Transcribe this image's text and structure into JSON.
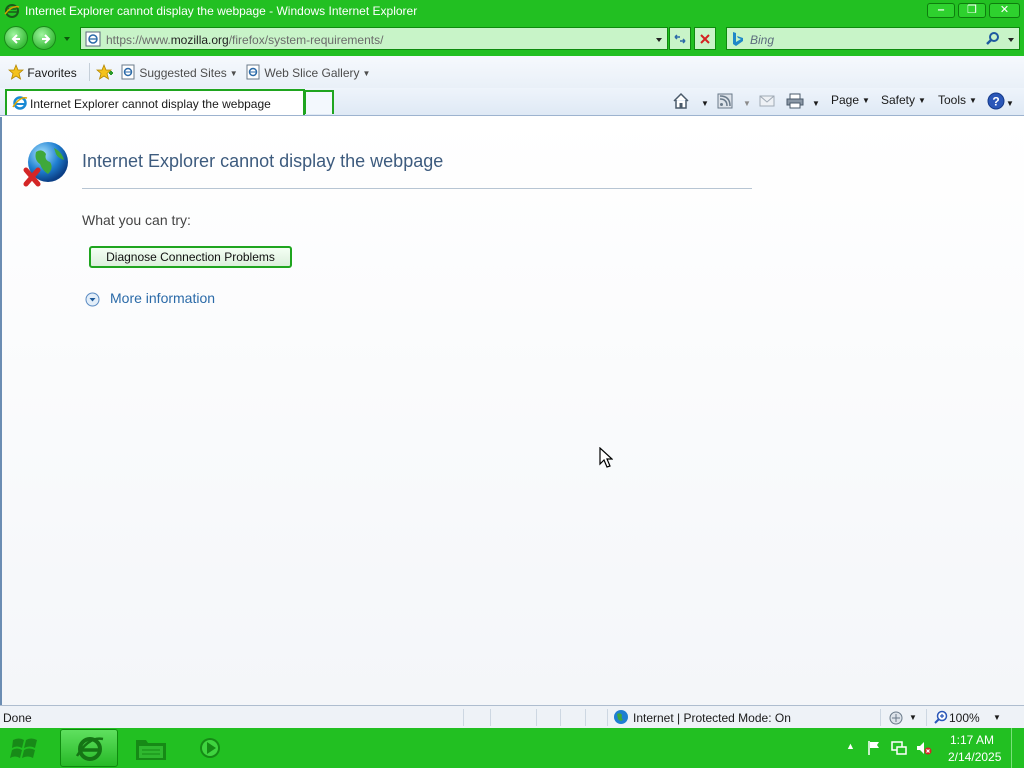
{
  "window": {
    "title": "Internet Explorer cannot display the webpage - Windows Internet Explorer",
    "minimize": "‒",
    "restore": "❐",
    "close": "✕"
  },
  "address_bar": {
    "url_prefix": "https://www.",
    "url_domain": "mozilla.org",
    "url_path": "/firefox/system-requirements/"
  },
  "search": {
    "placeholder": "Bing"
  },
  "favorites_bar": {
    "favorites_label": "Favorites",
    "suggested_sites_label": "Suggested Sites",
    "web_slice_gallery_label": "Web Slice Gallery"
  },
  "tab": {
    "label": "Internet Explorer cannot display the webpage"
  },
  "command_bar": {
    "page_label": "Page",
    "safety_label": "Safety",
    "tools_label": "Tools"
  },
  "content": {
    "heading": "Internet Explorer cannot display the webpage",
    "what_you_can_try": "What you can try:",
    "diagnose_button": "Diagnose Connection Problems",
    "more_information": "More information"
  },
  "status_bar": {
    "status_text": "Done",
    "zone_text": "Internet | Protected Mode: On",
    "zoom_level": "100%"
  },
  "taskbar": {
    "time": "1:17 AM",
    "date": "2/14/2025"
  },
  "colors": {
    "chrome_green": "#22c022",
    "tab_border_green": "#1fa51f",
    "heading_blue": "#3d5b7e",
    "link_blue": "#2b6aa8"
  }
}
